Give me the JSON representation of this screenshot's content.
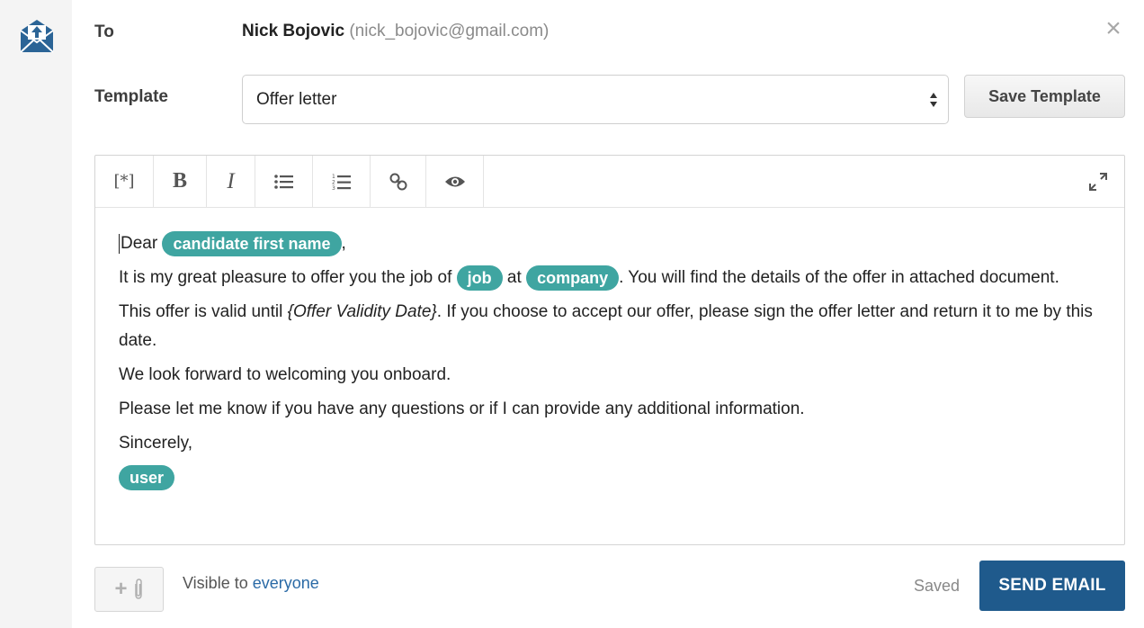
{
  "compose": {
    "to_label": "To",
    "recipient_name": "Nick Bojovic",
    "recipient_email": "(nick_bojovic@gmail.com)",
    "close_icon": "close-icon",
    "template_label": "Template",
    "template_selected": "Offer letter",
    "save_template_label": "Save Template"
  },
  "toolbar": {
    "merge_field_glyph": "[*]",
    "bold_glyph": "B",
    "italic_glyph": "I",
    "icons": [
      "merge-field-icon",
      "bold-icon",
      "italic-icon",
      "bulleted-list-icon",
      "numbered-list-icon",
      "link-icon",
      "preview-eye-icon",
      "expand-icon"
    ]
  },
  "body": {
    "greeting_text": "Dear",
    "greeting_comma": ",",
    "chip_candidate": "candidate first name",
    "p2_a": "It is my great pleasure to offer you the job of",
    "chip_job": "job",
    "p2_b": "at",
    "chip_company": "company",
    "p2_c": ". You will find the details of the offer in attached document.",
    "p3_a": "This offer is valid until",
    "p3_token": "{Offer Validity Date}",
    "p3_b": ". If you choose to accept our offer, please sign the offer letter and return it to me by this date.",
    "p4": "We look forward to welcoming you onboard.",
    "p5": "Please let me know if you have any questions or if I can provide any additional information.",
    "p6": "Sincerely,",
    "chip_user": "user"
  },
  "footer": {
    "attach_plus": "+",
    "visibility_prefix": "Visible to",
    "visibility_link": "everyone",
    "saved_status": "Saved",
    "send_label": "SEND EMAIL"
  },
  "colors": {
    "chip": "#3fa5a1",
    "send_button": "#1f5a8c",
    "link": "#2a6aa6"
  }
}
